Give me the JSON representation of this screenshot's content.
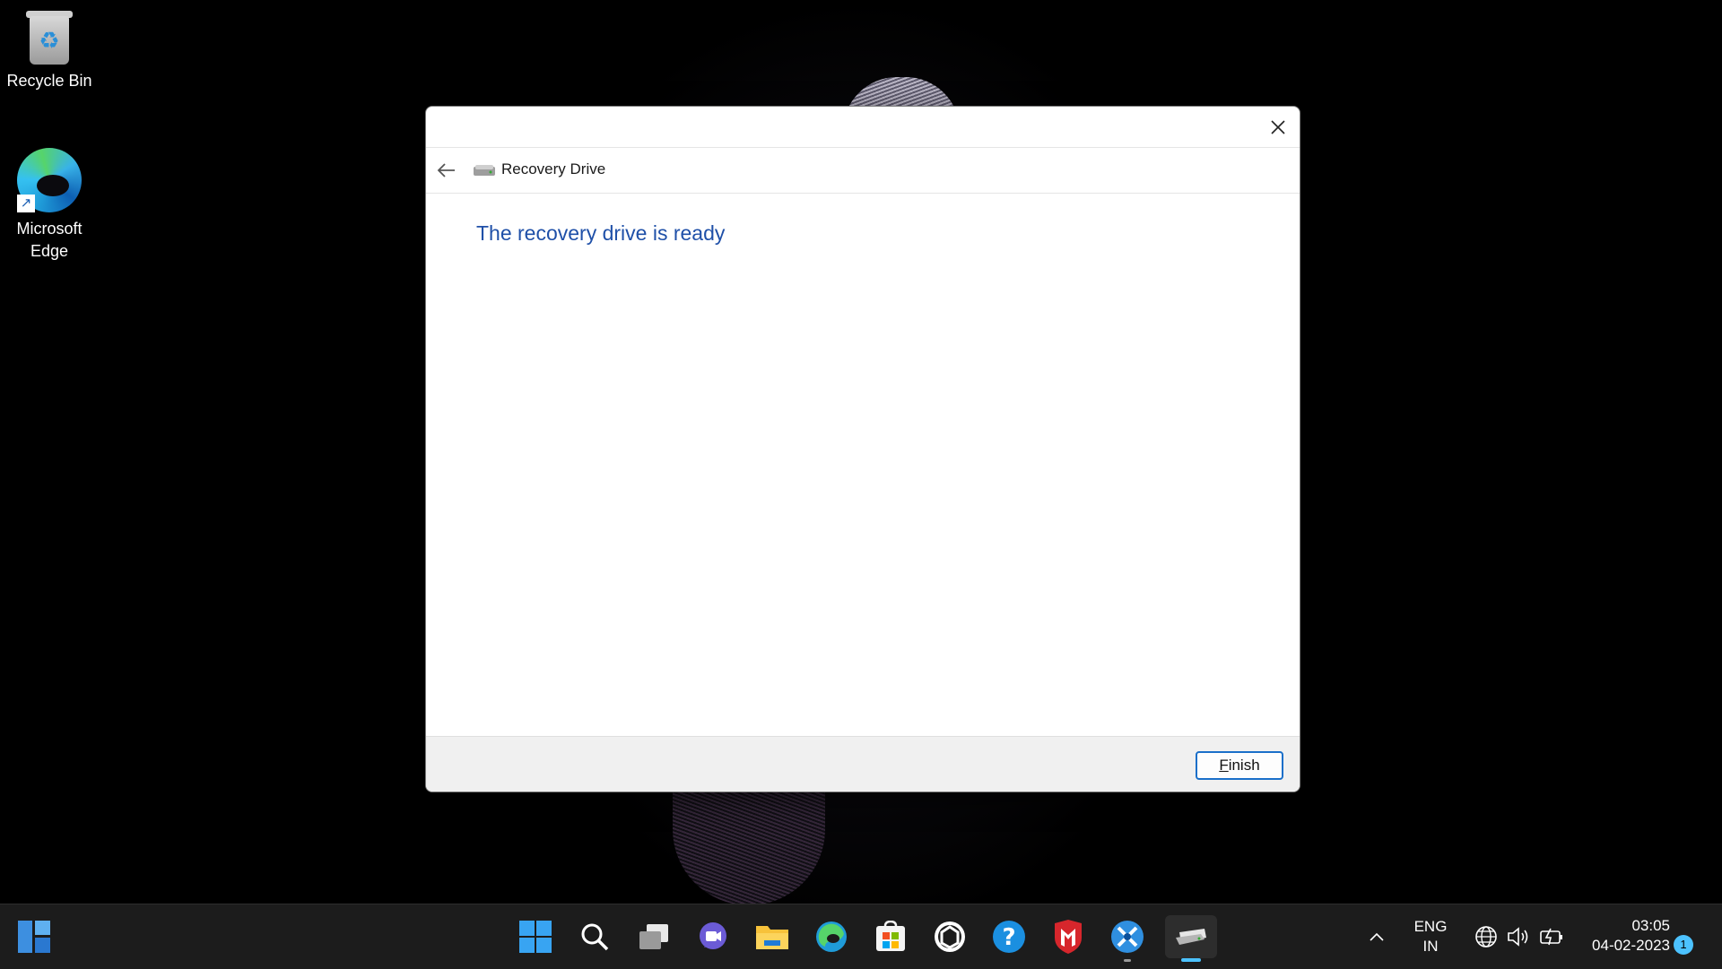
{
  "desktop": {
    "icons": [
      {
        "label": "Recycle Bin",
        "icon": "recycle-bin-icon"
      },
      {
        "label": "Microsoft Edge",
        "icon": "edge-icon"
      }
    ]
  },
  "dialog": {
    "nav_title": "Recovery Drive",
    "heading": "The recovery drive is ready",
    "finish_first_letter": "F",
    "finish_rest": "inish",
    "heading_color": "#1f50a8"
  },
  "taskbar": {
    "apps": [
      "widgets-icon",
      "start-icon",
      "search-icon",
      "task-view-icon",
      "chat-icon",
      "file-explorer-icon",
      "edge-icon",
      "store-icon",
      "app-icon",
      "get-help-icon",
      "mcafee-icon",
      "snipping-tool-icon",
      "recovery-drive-icon"
    ],
    "language_line1": "ENG",
    "language_line2": "IN",
    "time": "03:05",
    "date": "04-02-2023",
    "notification_count": "1",
    "accent": "#4cc2ff"
  }
}
